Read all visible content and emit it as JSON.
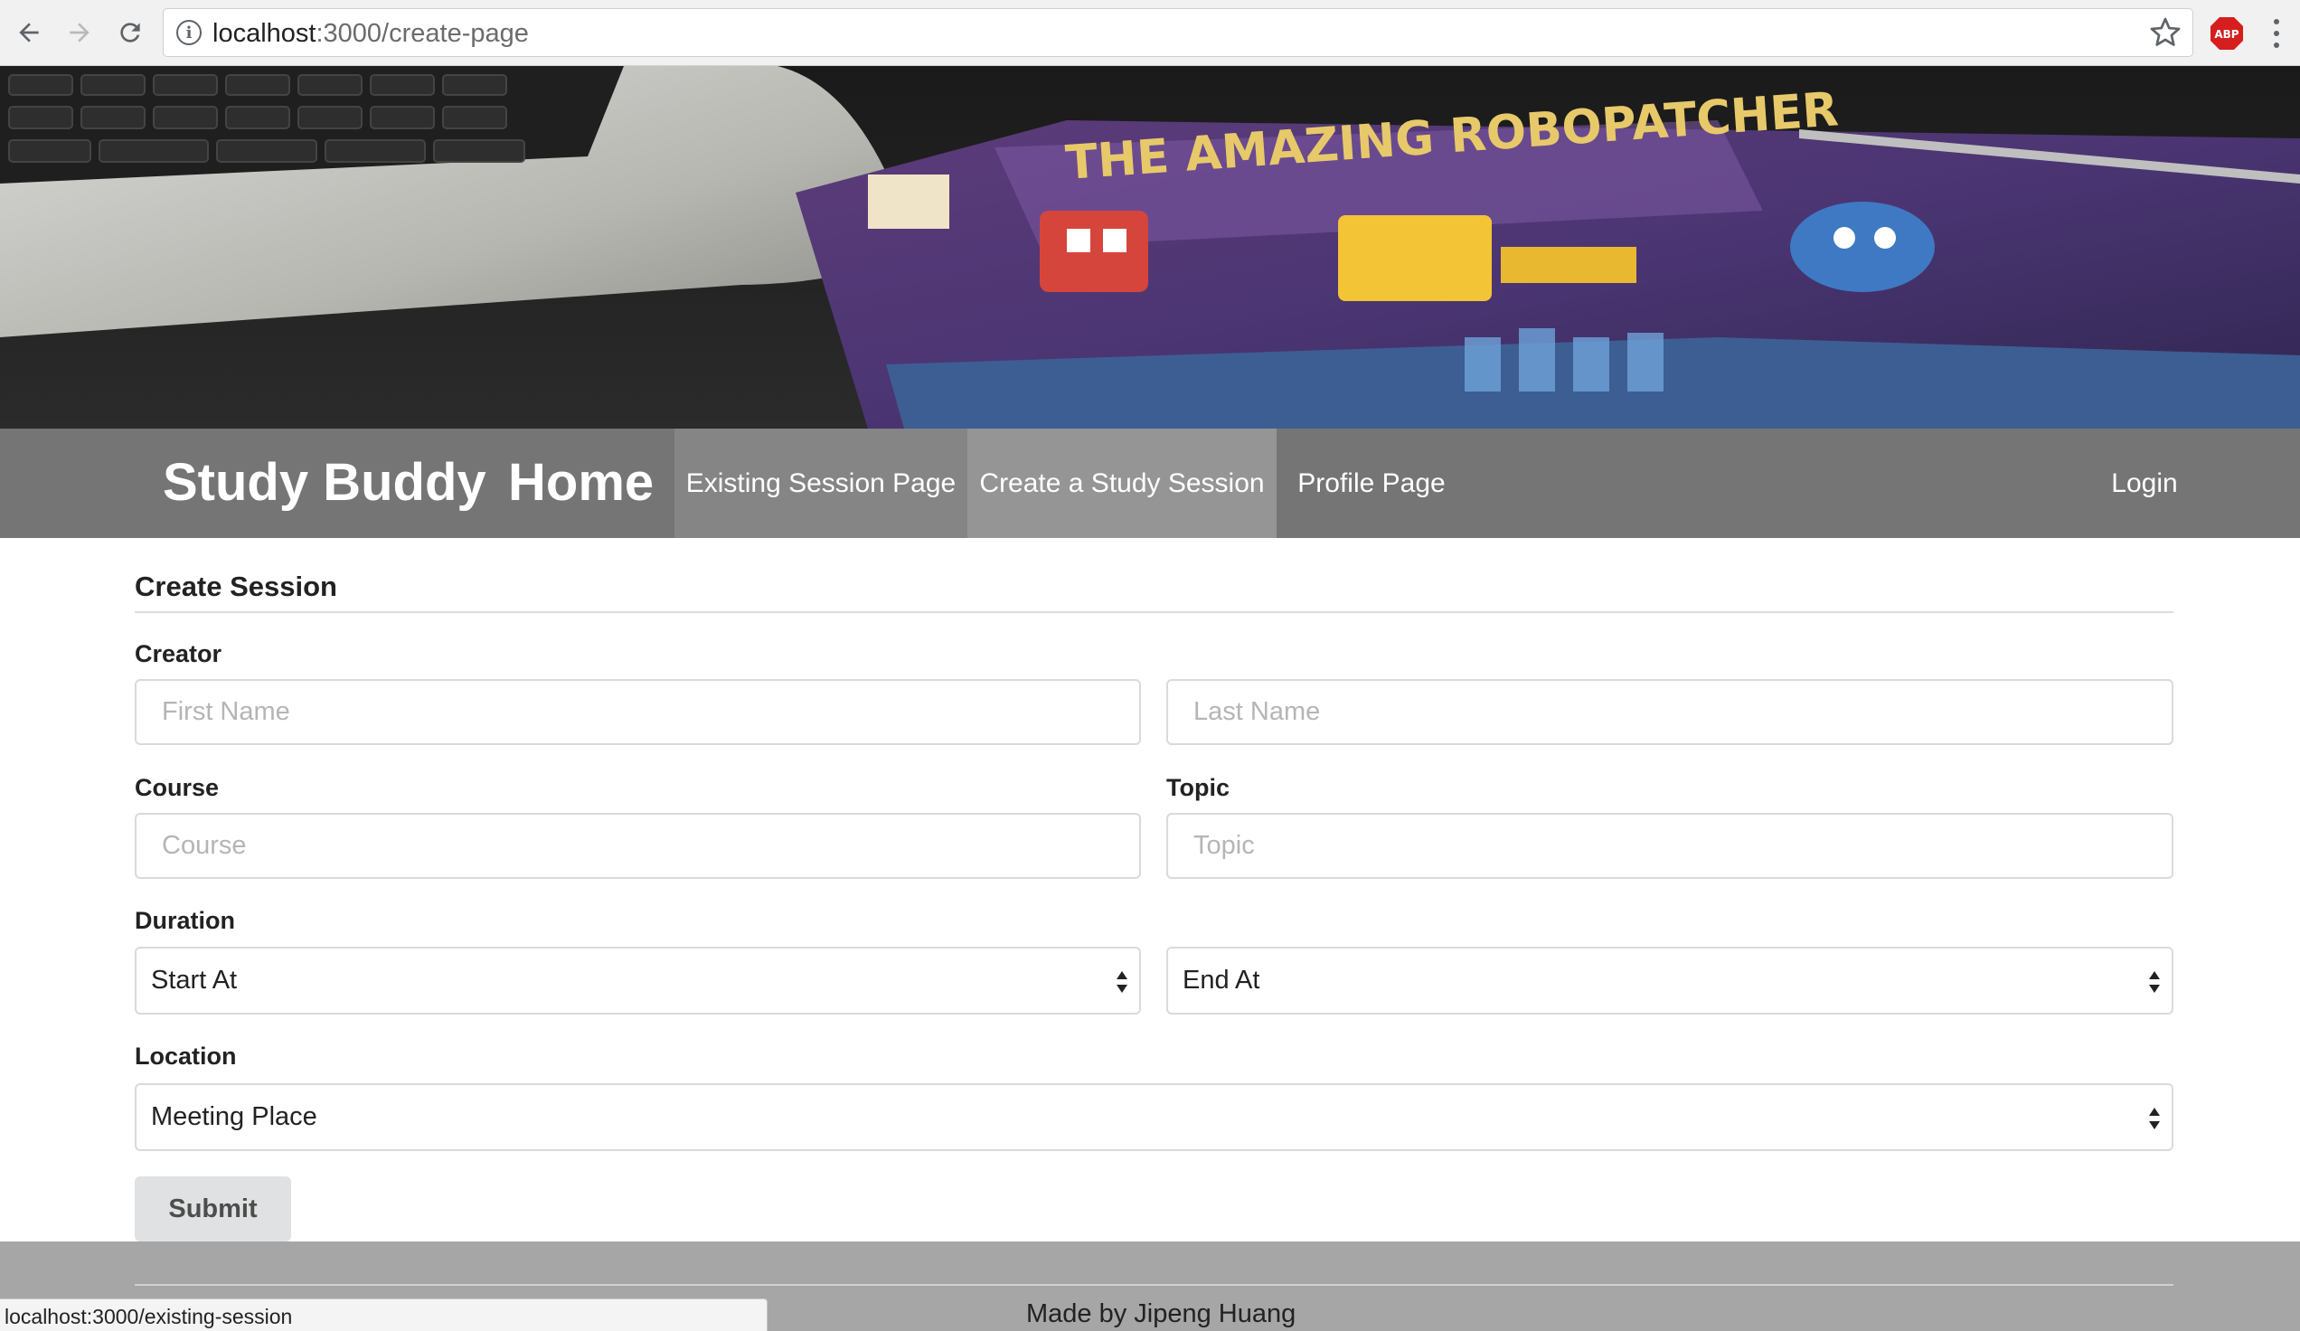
{
  "browser": {
    "url_host": "localhost",
    "url_path": ":3000/create-page",
    "status_url": "localhost:3000/existing-session",
    "extension_label": "ABP"
  },
  "navbar": {
    "brand": "Study Buddy",
    "home": "Home",
    "items": [
      {
        "label": "Existing Session Page"
      },
      {
        "label": "Create a Study Session",
        "active": true
      },
      {
        "label": "Profile Page"
      }
    ],
    "login": "Login"
  },
  "form": {
    "title": "Create Session",
    "creator_label": "Creator",
    "first_name_placeholder": "First Name",
    "last_name_placeholder": "Last Name",
    "course_label": "Course",
    "course_placeholder": "Course",
    "topic_label": "Topic",
    "topic_placeholder": "Topic",
    "duration_label": "Duration",
    "start_value": "Start At",
    "end_value": "End At",
    "location_label": "Location",
    "location_value": "Meeting Place",
    "submit_label": "Submit"
  },
  "footer": {
    "credit": "Made by Jipeng Huang"
  },
  "colors": {
    "navbar_bg": "#757575",
    "nav_active_bg": "#959595",
    "footer_bg": "#a6a6a6",
    "submit_bg": "#e0e1e2"
  }
}
